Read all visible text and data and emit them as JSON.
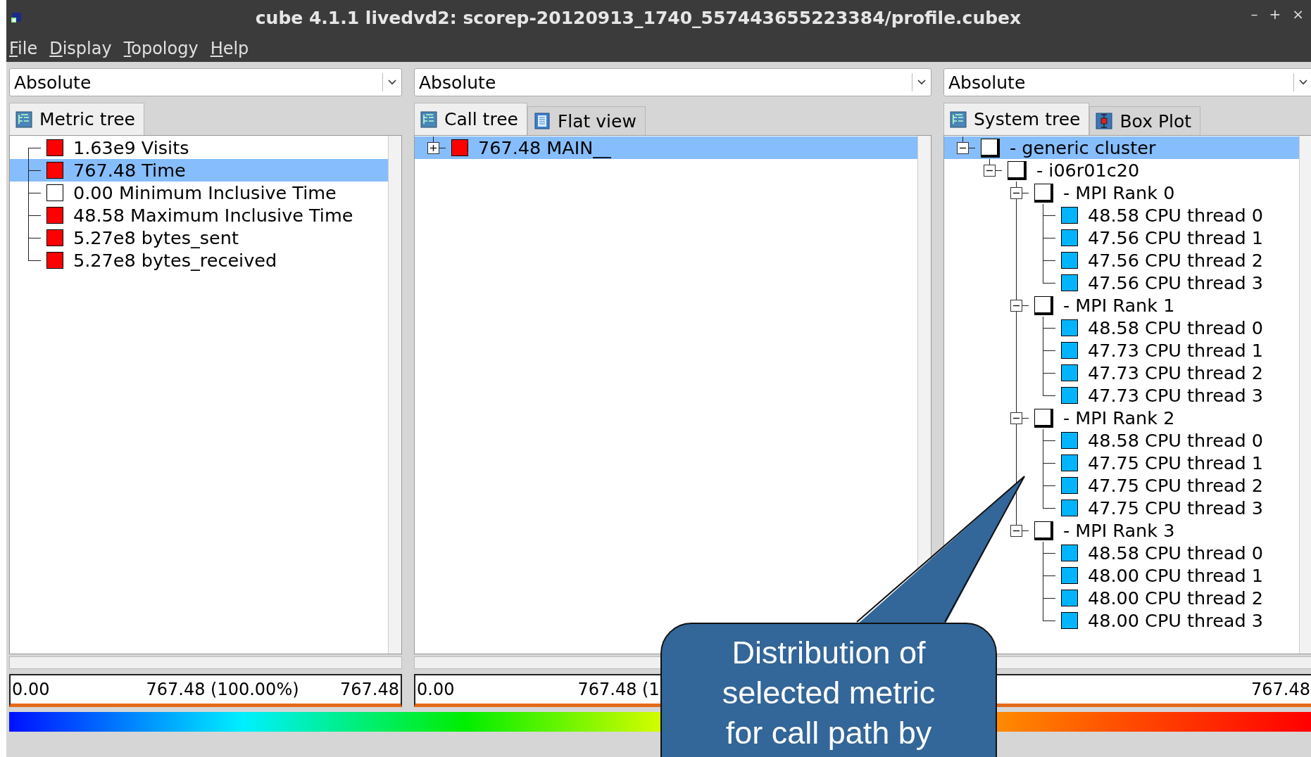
{
  "window": {
    "title": "cube 4.1.1 livedvd2: scorep-20120913_1740_557443655223384/profile.cubex",
    "controls": [
      "–",
      "+",
      "×"
    ]
  },
  "menu": [
    "File",
    "Display",
    "Topology",
    "Help"
  ],
  "panels": [
    {
      "mode": "Absolute",
      "tabs": [
        {
          "label": "Metric tree",
          "kind": "tree",
          "selected": true
        }
      ],
      "tree": [
        {
          "label": "1.63e9 Visits",
          "color": "#ff0000",
          "selected": false
        },
        {
          "label": "767.48 Time",
          "color": "#ff0000",
          "selected": true
        },
        {
          "label": "0.00 Minimum Inclusive Time",
          "color": "#ffffff",
          "selected": false
        },
        {
          "label": "48.58 Maximum Inclusive Time",
          "color": "#ff0000",
          "selected": false
        },
        {
          "label": "5.27e8 bytes_sent",
          "color": "#ff0000",
          "selected": false
        },
        {
          "label": "5.27e8 bytes_received",
          "color": "#ff0000",
          "selected": false
        }
      ],
      "value_bar": {
        "min": "0.00",
        "mid": "767.48 (100.00%)",
        "max": "767.48"
      }
    },
    {
      "mode": "Absolute",
      "tabs": [
        {
          "label": "Call tree",
          "kind": "tree",
          "selected": true
        },
        {
          "label": "Flat view",
          "kind": "flat",
          "selected": false
        }
      ],
      "tree": [
        {
          "label": "767.48 MAIN__",
          "color": "#ff0000",
          "selected": true,
          "expanded": false
        }
      ],
      "value_bar": {
        "min": "0.00",
        "mid": "767.48 (1"
      }
    },
    {
      "mode": "Absolute",
      "tabs": [
        {
          "label": "System tree",
          "kind": "tree",
          "selected": true
        },
        {
          "label": "Box Plot",
          "kind": "boxplot",
          "selected": false
        }
      ],
      "tree": [
        {
          "label": "- generic cluster",
          "color": "#ffffff",
          "selected": true,
          "expanded": true,
          "children": [
            {
              "label": "- i06r01c20",
              "color": "#ffffff",
              "selected": false,
              "expanded": true,
              "children": [
                {
                  "label": "- MPI Rank 0",
                  "color": "#ffffff",
                  "selected": false,
                  "expanded": true,
                  "children": [
                    {
                      "label": "48.58 CPU thread 0",
                      "color": "#00b4ff",
                      "selected": false
                    },
                    {
                      "label": "47.56 CPU thread 1",
                      "color": "#00b4ff",
                      "selected": false
                    },
                    {
                      "label": "47.56 CPU thread 2",
                      "color": "#00b4ff",
                      "selected": false
                    },
                    {
                      "label": "47.56 CPU thread 3",
                      "color": "#00b4ff",
                      "selected": false
                    }
                  ]
                },
                {
                  "label": "- MPI Rank 1",
                  "color": "#ffffff",
                  "selected": false,
                  "expanded": true,
                  "children": [
                    {
                      "label": "48.58 CPU thread 0",
                      "color": "#00b4ff",
                      "selected": false
                    },
                    {
                      "label": "47.73 CPU thread 1",
                      "color": "#00b4ff",
                      "selected": false
                    },
                    {
                      "label": "47.73 CPU thread 2",
                      "color": "#00b4ff",
                      "selected": false
                    },
                    {
                      "label": "47.73 CPU thread 3",
                      "color": "#00b4ff",
                      "selected": false
                    }
                  ]
                },
                {
                  "label": "- MPI Rank 2",
                  "color": "#ffffff",
                  "selected": false,
                  "expanded": true,
                  "children": [
                    {
                      "label": "48.58 CPU thread 0",
                      "color": "#00b4ff",
                      "selected": false
                    },
                    {
                      "label": "47.75 CPU thread 1",
                      "color": "#00b4ff",
                      "selected": false
                    },
                    {
                      "label": "47.75 CPU thread 2",
                      "color": "#00b4ff",
                      "selected": false
                    },
                    {
                      "label": "47.75 CPU thread 3",
                      "color": "#00b4ff",
                      "selected": false
                    }
                  ]
                },
                {
                  "label": "- MPI Rank 3",
                  "color": "#ffffff",
                  "selected": false,
                  "expanded": true,
                  "children": [
                    {
                      "label": "48.58 CPU thread 0",
                      "color": "#00b4ff",
                      "selected": false
                    },
                    {
                      "label": "48.00 CPU thread 1",
                      "color": "#00b4ff",
                      "selected": false
                    },
                    {
                      "label": "48.00 CPU thread 2",
                      "color": "#00b4ff",
                      "selected": false
                    },
                    {
                      "label": "48.00 CPU thread 3",
                      "color": "#00b4ff",
                      "selected": false
                    }
                  ]
                }
              ]
            }
          ]
        }
      ],
      "value_bar": {
        "max": "767.48"
      }
    }
  ],
  "callout": {
    "text": "Distribution of selected metric for call path by"
  }
}
